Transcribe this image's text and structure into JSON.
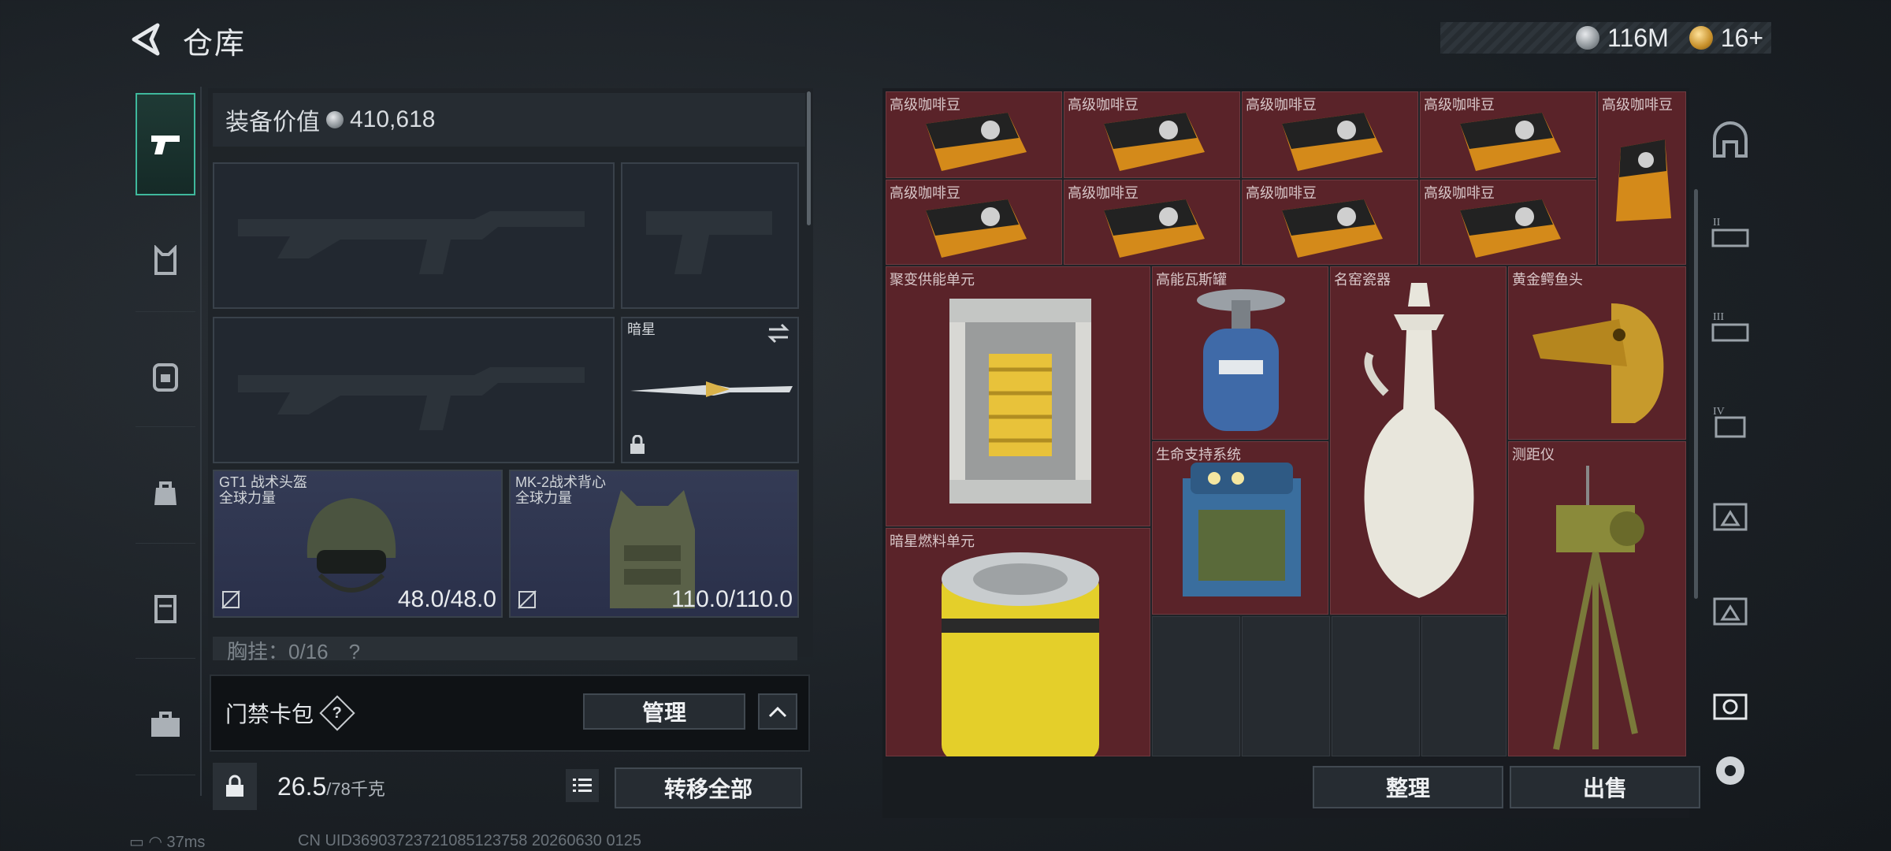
{
  "header": {
    "title": "仓库"
  },
  "currency": {
    "silver": "116M",
    "gold": "16+"
  },
  "nav": {
    "items": [
      "weapons",
      "vest",
      "backpack",
      "bag",
      "case",
      "briefcase"
    ]
  },
  "equipment": {
    "value_label": "装备价值",
    "value": "410,618",
    "melee_label": "暗星",
    "helmet": {
      "name": "GT1 战术头盔",
      "sub": "全球力量",
      "durability": "48.0/48.0"
    },
    "vest": {
      "name": "MK-2战术背心",
      "sub": "全球力量",
      "durability": "110.0/110.0"
    },
    "chest_rig": "胸挂：0/16　?"
  },
  "keycard": {
    "label": "门禁卡包",
    "help": "?",
    "manage": "管理"
  },
  "weight": {
    "current": "26.5",
    "max": "/78千克"
  },
  "transfer_all": "转移全部",
  "stash": {
    "items": {
      "coffee": "高级咖啡豆",
      "fusion": "聚变供能单元",
      "gas": "高能瓦斯罐",
      "vase": "名窑瓷器",
      "croc": "黄金鳄鱼头",
      "life": "生命支持系统",
      "range": "测距仪",
      "fuel": "暗星燃料单元"
    },
    "sort": "整理",
    "sell": "出售"
  },
  "status": {
    "ping": "37ms",
    "uid": "CN UID3690372372108512375​8 20260630 0125"
  }
}
